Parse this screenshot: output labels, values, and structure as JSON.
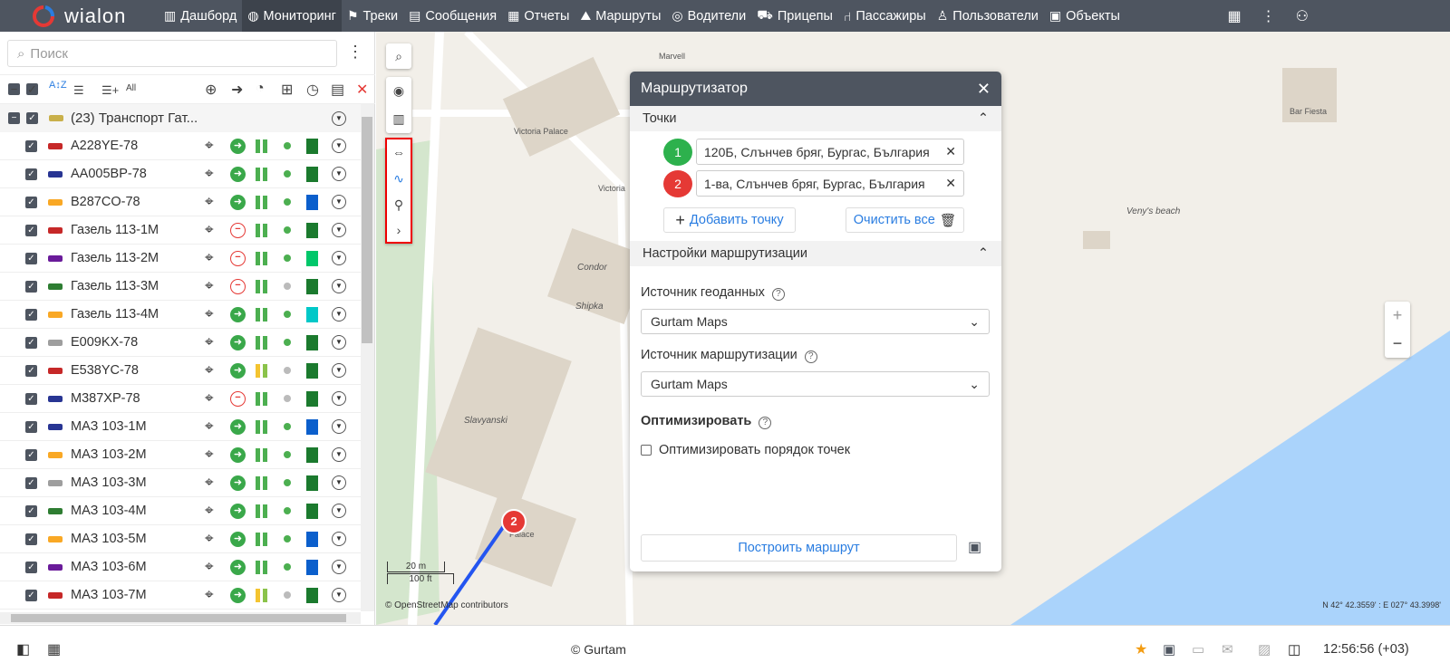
{
  "app": {
    "logo": "wialon"
  },
  "nav": [
    {
      "label": "Дашборд",
      "icon": "chart-icon"
    },
    {
      "label": "Мониторинг",
      "icon": "globe-icon",
      "active": true
    },
    {
      "label": "Треки",
      "icon": "flag-icon"
    },
    {
      "label": "Сообщения",
      "icon": "messages-icon"
    },
    {
      "label": "Отчеты",
      "icon": "report-icon"
    },
    {
      "label": "Маршруты",
      "icon": "route-icon"
    },
    {
      "label": "Водители",
      "icon": "steering-icon"
    },
    {
      "label": "Прицепы",
      "icon": "trailer-icon"
    },
    {
      "label": "Пассажиры",
      "icon": "seat-icon"
    },
    {
      "label": "Пользователи",
      "icon": "user-icon"
    },
    {
      "label": "Объекты",
      "icon": "bus-icon"
    }
  ],
  "sidebar": {
    "search_placeholder": "Поиск",
    "group": {
      "label": "(23) Транспорт Гат..."
    },
    "units": [
      {
        "name": "A228YE-78",
        "car": "#c62828",
        "motion": "moving",
        "speed": "green",
        "dot": "#4caf50",
        "square": "#1b7a2e"
      },
      {
        "name": "AA005BP-78",
        "car": "#283593",
        "motion": "moving",
        "speed": "green",
        "dot": "#4caf50",
        "square": "#1b7a2e"
      },
      {
        "name": "B287CO-78",
        "car": "#f9a825",
        "motion": "moving",
        "speed": "green",
        "dot": "#4caf50",
        "square": "#0b5fcc"
      },
      {
        "name": "Газель 113-1М",
        "car": "#c62828",
        "motion": "stopped",
        "speed": "green",
        "dot": "#4caf50",
        "square": "#1b7a2e"
      },
      {
        "name": "Газель 113-2М",
        "car": "#6a1b9a",
        "motion": "stopped",
        "speed": "green",
        "dot": "#4caf50",
        "square": "#00c76a"
      },
      {
        "name": "Газель 113-3М",
        "car": "#2e7d32",
        "motion": "stopped",
        "speed": "green",
        "dot": "#bbbbbb",
        "square": "#1b7a2e"
      },
      {
        "name": "Газель 113-4М",
        "car": "#f9a825",
        "motion": "moving",
        "speed": "green",
        "dot": "#4caf50",
        "square": "#00c8c8"
      },
      {
        "name": "E009KX-78",
        "car": "#9e9e9e",
        "motion": "moving",
        "speed": "green",
        "dot": "#4caf50",
        "square": "#1b7a2e"
      },
      {
        "name": "E538YC-78",
        "car": "#c62828",
        "motion": "moving",
        "speed": "yellow",
        "dot": "#bbbbbb",
        "square": "#1b7a2e"
      },
      {
        "name": "M387XP-78",
        "car": "#283593",
        "motion": "stopped",
        "speed": "green",
        "dot": "#bbbbbb",
        "square": "#1b7a2e"
      },
      {
        "name": "МАЗ 103-1М",
        "car": "#283593",
        "motion": "moving",
        "speed": "green",
        "dot": "#4caf50",
        "square": "#0b5fcc"
      },
      {
        "name": "МАЗ 103-2М",
        "car": "#f9a825",
        "motion": "moving",
        "speed": "green",
        "dot": "#4caf50",
        "square": "#1b7a2e"
      },
      {
        "name": "МАЗ 103-3М",
        "car": "#9e9e9e",
        "motion": "moving",
        "speed": "green",
        "dot": "#4caf50",
        "square": "#1b7a2e"
      },
      {
        "name": "МАЗ 103-4М",
        "car": "#2e7d32",
        "motion": "moving",
        "speed": "green",
        "dot": "#4caf50",
        "square": "#1b7a2e"
      },
      {
        "name": "МАЗ 103-5М",
        "car": "#f9a825",
        "motion": "moving",
        "speed": "green",
        "dot": "#4caf50",
        "square": "#0b5fcc"
      },
      {
        "name": "МАЗ 103-6М",
        "car": "#6a1b9a",
        "motion": "moving",
        "speed": "green",
        "dot": "#4caf50",
        "square": "#0b5fcc"
      },
      {
        "name": "МАЗ 103-7М",
        "car": "#c62828",
        "motion": "moving",
        "speed": "yellow",
        "dot": "#bbbbbb",
        "square": "#1b7a2e"
      }
    ]
  },
  "map": {
    "labels": [
      "Marvell",
      "Victoria Palace",
      "Victoria",
      "Condor",
      "Shipka",
      "Slavyanski",
      "Palace",
      "Bar Fiesta",
      "Veny's beach"
    ],
    "scale_m": "20 m",
    "scale_ft": "100 ft",
    "attribution": "© OpenStreetMap contributors",
    "coords": "N 42° 42.3559' : E 027° 43.3998'",
    "marker": "2"
  },
  "router": {
    "title": "Маршрутизатор",
    "points_section": "Точки",
    "points": [
      {
        "n": "1",
        "value": "120Б, Слънчев бряг, Бургас, България",
        "color": "#2db14d"
      },
      {
        "n": "2",
        "value": "1-ва, Слънчев бряг, Бургас, България",
        "color": "#e53935"
      }
    ],
    "add_point": "Добавить точку",
    "clear_all": "Очистить все",
    "settings_section": "Настройки маршрутизации",
    "geo_source_label": "Источник геоданных",
    "geo_source": "Gurtam Maps",
    "route_source_label": "Источник маршрутизации",
    "route_source": "Gurtam Maps",
    "optimize_label": "Оптимизировать",
    "optimize_checkbox": "Оптимизировать порядок точек",
    "optimize_checked": false,
    "build": "Построить маршрут"
  },
  "footer": {
    "copyright": "© Gurtam",
    "time": "12:56:56 (+03)"
  }
}
